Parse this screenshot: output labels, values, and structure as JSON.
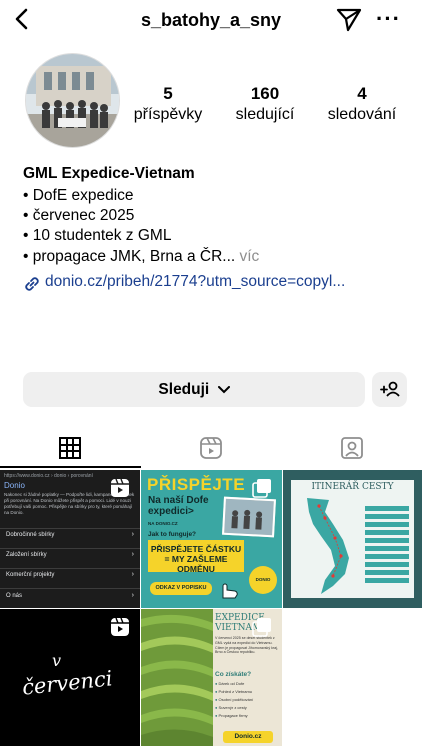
{
  "header": {
    "back_glyph": "<",
    "username": "s_batohy_a_sny",
    "more_glyph": "···"
  },
  "stats": [
    {
      "count": "5",
      "label": "příspěvky"
    },
    {
      "count": "160",
      "label": "sledující"
    },
    {
      "count": "4",
      "label": "sledování"
    }
  ],
  "bio": {
    "name": "GML Expedice-Vietnam",
    "lines": [
      "• DofE expedice",
      "• červenec 2025",
      "• 10 studentek z GML",
      "• propagace JMK, Brna a ČR..."
    ],
    "more": " víc",
    "link": "donio.cz/pribeh/21774?utm_source=copyl..."
  },
  "actions": {
    "follow_label": "Sleduji",
    "follow_chevron": "⌄"
  },
  "posts": {
    "p1": {
      "url": "https://www.donio.cz › donio › porovnání",
      "title": "Donio",
      "text": "Nakonec si žádné poplatky — Podpořte lidi, kampaně a majetek při porovnání. Na Donio můžete přispět a pomoci. Lidé v nouzi potřebují vaši pomoc. Přispějte na sbírky pro ty, které pomáhají na Donio.",
      "menu": [
        "Dobročinné sbírky",
        "Založení sbírky",
        "Komerční projekty",
        "O nás"
      ]
    },
    "p2": {
      "title": "PŘISPĚJTE",
      "sub": "Na naší Dofe expedici>",
      "sub2": "NA DONIO.CZ",
      "q": "Jak to funguje?",
      "box": "PŘISPĚJETE ČÁSTKU = MY ZAŠLEME ODMĚNU",
      "btn": "ODKAZ V POPISKU",
      "badge": "DONIO"
    },
    "p3": {
      "title": "ITINERÁŘ CESTY"
    },
    "p4": {
      "text1": "v",
      "text2": "červenci"
    },
    "p5": {
      "title": "EXPEDICE VIETNAM",
      "body": "V červenci 2025 se deset studentek z GML vydá na expedici do Vietnamu. Cílem je propagovat Jihomoravský kraj, Brno a Českou republiku.",
      "rewards_title": "Co získáte?",
      "rewards": [
        "Dárek od Dofe",
        "Pohled z Vietnamu",
        "Osobní poděkování",
        "Suvenýr z cesty",
        "Propagace firmy"
      ],
      "btn": "Donio.cz"
    }
  },
  "colors": {
    "link": "#1b3f8f",
    "button_bg": "#efefef",
    "post2_bg": "#3aa7a3",
    "post2_yellow": "#f5d32a",
    "post3_bg": "#2f5e60",
    "post5_bg": "#ece6d6"
  }
}
